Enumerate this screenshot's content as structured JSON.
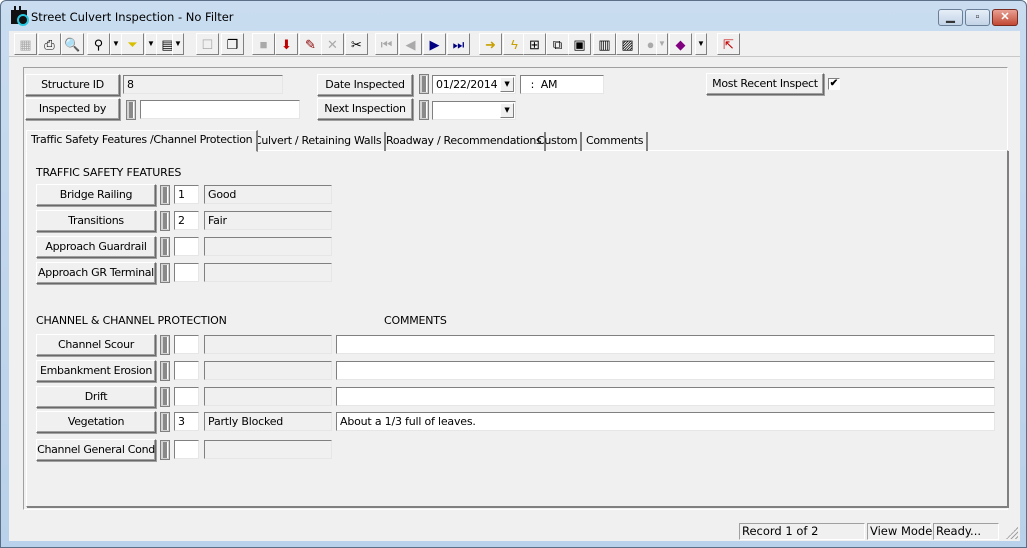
{
  "window": {
    "title": "Street Culvert Inspection - No Filter",
    "controls": [
      "minimize",
      "maximize",
      "close"
    ]
  },
  "toolbar": {
    "buttons": [
      {
        "name": "form-view-icon",
        "glyph": "▦",
        "disabled": true
      },
      {
        "name": "print-icon",
        "glyph": "⎙"
      },
      {
        "name": "print-preview-icon",
        "glyph": "🔍"
      },
      {
        "name": "find-icon",
        "glyph": "⚲"
      },
      {
        "name": "find-dropdown",
        "glyph": "▼",
        "dropdown": true
      },
      {
        "name": "filter-icon",
        "glyph": "⏷"
      },
      {
        "name": "filter-dropdown",
        "glyph": "▼",
        "dropdown": true
      },
      {
        "name": "report-icon",
        "glyph": "▤"
      },
      {
        "name": "report-dropdown",
        "glyph": "▼",
        "dropdown": true
      },
      {
        "name": "properties-icon",
        "glyph": "☐",
        "disabled": true
      },
      {
        "name": "copy-record-icon",
        "glyph": "❐"
      },
      {
        "name": "save-icon",
        "glyph": "■",
        "disabled": true
      },
      {
        "name": "add-record-icon",
        "glyph": "⬇"
      },
      {
        "name": "edit-icon",
        "glyph": "✎"
      },
      {
        "name": "cancel-icon",
        "glyph": "✕",
        "disabled": true
      },
      {
        "name": "delete-icon",
        "glyph": "✂"
      },
      {
        "name": "first-record-icon",
        "glyph": "⏮",
        "disabled": true
      },
      {
        "name": "previous-record-icon",
        "glyph": "◀",
        "disabled": true
      },
      {
        "name": "next-record-icon",
        "glyph": "▶"
      },
      {
        "name": "last-record-icon",
        "glyph": "⏭"
      },
      {
        "name": "goto-icon",
        "glyph": "➜"
      },
      {
        "name": "quick-action-icon",
        "glyph": "ϟ"
      },
      {
        "name": "map-layers-icon",
        "glyph": "⊞"
      },
      {
        "name": "relationships-icon",
        "glyph": "⧉"
      },
      {
        "name": "gis-map-icon",
        "glyph": "▣"
      },
      {
        "name": "calculator-icon",
        "glyph": "▥"
      },
      {
        "name": "photo-icon",
        "glyph": "▨"
      },
      {
        "name": "globe-icon",
        "glyph": "●",
        "disabled": true
      },
      {
        "name": "globe-dropdown",
        "glyph": "▼",
        "dropdown": true,
        "disabled": true
      },
      {
        "name": "help-book-icon",
        "glyph": "◆"
      },
      {
        "name": "help-dropdown",
        "glyph": "▼",
        "dropdown": true
      },
      {
        "name": "exit-icon",
        "glyph": "⇱"
      }
    ]
  },
  "header": {
    "structure_id": {
      "label": "Structure ID",
      "value": "8"
    },
    "inspected_by": {
      "label": "Inspected by",
      "value": ""
    },
    "date_inspected": {
      "label": "Date Inspected",
      "date": "01/22/2014",
      "time": "  :  AM"
    },
    "next_inspection": {
      "label": "Next Inspection",
      "date": " /  /"
    },
    "most_recent": {
      "label": "Most Recent Inspect",
      "checked": true,
      "check_glyph": "✔"
    }
  },
  "tabs": [
    {
      "label": "Traffic Safety Features /Channel Protection",
      "active": true
    },
    {
      "label": "Culvert / Retaining Walls"
    },
    {
      "label": "Roadway / Recommendations"
    },
    {
      "label": "Custom"
    },
    {
      "label": "Comments"
    }
  ],
  "traffic_safety": {
    "heading": "TRAFFIC SAFETY FEATURES",
    "rows": [
      {
        "label": "Bridge Railing",
        "code": "1",
        "desc": "Good"
      },
      {
        "label": "Transitions",
        "code": "2",
        "desc": "Fair"
      },
      {
        "label": "Approach Guardrail",
        "code": "",
        "desc": ""
      },
      {
        "label": "Approach GR Terminal",
        "code": "",
        "desc": ""
      }
    ]
  },
  "channel": {
    "heading": "CHANNEL & CHANNEL PROTECTION",
    "comments_heading": "COMMENTS",
    "rows": [
      {
        "label": "Channel Scour",
        "code": "",
        "desc": "",
        "comment": ""
      },
      {
        "label": "Embankment Erosion",
        "code": "",
        "desc": "",
        "comment": ""
      },
      {
        "label": "Drift",
        "code": "",
        "desc": "",
        "comment": ""
      },
      {
        "label": "Vegetation",
        "code": "3",
        "desc": "Partly Blocked",
        "comment": "About a 1/3 full of leaves."
      },
      {
        "label": "Channel General Cond",
        "code": "",
        "desc": ""
      }
    ]
  },
  "statusbar": {
    "record": "Record 1 of 2",
    "mode": "View Mode",
    "status": "Ready..."
  }
}
